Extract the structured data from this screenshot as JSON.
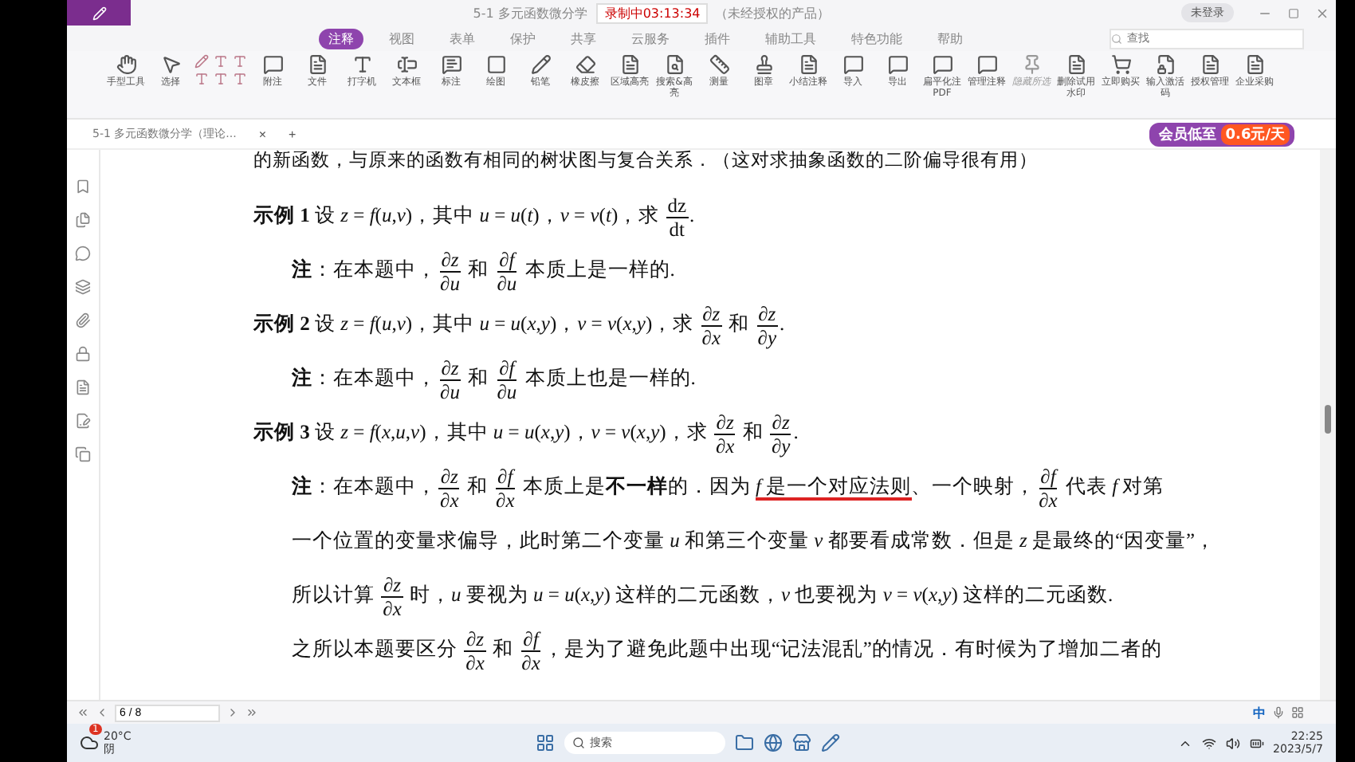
{
  "title_bar": {
    "doc_title": "5-1 多元函数微分学",
    "recording": "录制中03:13:34",
    "product_note": "（未经授权的产品）",
    "login": "未登录"
  },
  "menu_tabs": [
    {
      "label": "注释",
      "selected": true
    },
    {
      "label": "视图",
      "selected": false
    },
    {
      "label": "表单",
      "selected": false
    },
    {
      "label": "保护",
      "selected": false
    },
    {
      "label": "共享",
      "selected": false
    },
    {
      "label": "云服务",
      "selected": false
    },
    {
      "label": "插件",
      "selected": false
    },
    {
      "label": "辅助工具",
      "selected": false
    },
    {
      "label": "特色功能",
      "selected": false
    },
    {
      "label": "帮助",
      "selected": false
    }
  ],
  "search": {
    "placeholder": "查找"
  },
  "ribbon": [
    {
      "kind": "hand",
      "label": "手型工具",
      "disabled": false
    },
    {
      "kind": "select",
      "label": "选择",
      "disabled": false
    },
    {
      "kind": "textmarks",
      "disabled": false
    },
    {
      "kind": "note",
      "label": "附注",
      "disabled": false
    },
    {
      "kind": "file",
      "label": "文件",
      "disabled": false
    },
    {
      "kind": "type",
      "label": "打字机",
      "disabled": false
    },
    {
      "kind": "textbox",
      "label": "文本框",
      "disabled": false
    },
    {
      "kind": "callout",
      "label": "标注",
      "disabled": false
    },
    {
      "kind": "shape",
      "label": "绘图",
      "disabled": false
    },
    {
      "kind": "pencil",
      "label": "铅笔",
      "disabled": false
    },
    {
      "kind": "eraser",
      "label": "橡皮擦",
      "disabled": false
    },
    {
      "kind": "file",
      "label": "区域高亮",
      "disabled": false
    },
    {
      "kind": "search",
      "label": "搜索&高亮",
      "disabled": false
    },
    {
      "kind": "measure",
      "label": "测量",
      "disabled": false
    },
    {
      "kind": "stamp",
      "label": "图章",
      "disabled": false
    },
    {
      "kind": "file",
      "label": "小结注释",
      "disabled": false
    },
    {
      "kind": "note",
      "label": "导入",
      "disabled": false
    },
    {
      "kind": "note",
      "label": "导出",
      "disabled": false
    },
    {
      "kind": "note",
      "label": "扁平化注PDF",
      "disabled": false
    },
    {
      "kind": "note",
      "label": "管理注释",
      "disabled": false
    },
    {
      "kind": "pin",
      "label": "隐藏所选",
      "disabled": true
    },
    {
      "kind": "file",
      "label": "删除试用水印",
      "disabled": false
    },
    {
      "kind": "cart",
      "label": "立即购买",
      "disabled": false
    },
    {
      "kind": "lock",
      "label": "输入激活码",
      "disabled": false
    },
    {
      "kind": "file",
      "label": "授权管理",
      "disabled": false
    },
    {
      "kind": "file",
      "label": "企业采购",
      "disabled": false
    }
  ],
  "doc_tab": {
    "label": "5-1 多元函数微分学（理论...",
    "close": "×",
    "add": "+"
  },
  "promo": {
    "label": "会员低至",
    "price": "0.6元/天"
  },
  "paragraphs": [
    {
      "kind": "cut",
      "segments": [
        {
          "kind": "text",
          "text": "的新函数，与原来的函数有相同的树状图与复合关系．（这对求抽象函数的二阶偏导很有用）"
        }
      ]
    },
    {
      "kind": "example",
      "segments": [
        {
          "kind": "label",
          "text": "示例 1"
        },
        {
          "kind": "text",
          "text": " 设 *z* = *f*(*u*,*v*)，其中 *u* = *u*(*t*)，*v* = *v*(*t*)，求 "
        },
        {
          "kind": "frac",
          "num": "dz",
          "den": "dt"
        },
        {
          "kind": "text",
          "text": "."
        }
      ]
    },
    {
      "kind": "note",
      "segments": [
        {
          "kind": "label",
          "text": "注"
        },
        {
          "kind": "text",
          "text": "：在本题中，"
        },
        {
          "kind": "frac",
          "num": "∂*z*",
          "den": "∂*u*"
        },
        {
          "kind": "text",
          "text": " 和 "
        },
        {
          "kind": "frac",
          "num": "∂*f*",
          "den": "∂*u*"
        },
        {
          "kind": "text",
          "text": " 本质上是一样的."
        }
      ]
    },
    {
      "kind": "example",
      "segments": [
        {
          "kind": "label",
          "text": "示例 2"
        },
        {
          "kind": "text",
          "text": " 设 *z* = *f*(*u*,*v*)，其中 *u* = *u*(*x*,*y*)，*v* = *v*(*x*,*y*)，求 "
        },
        {
          "kind": "frac",
          "num": "∂*z*",
          "den": "∂*x*"
        },
        {
          "kind": "text",
          "text": " 和 "
        },
        {
          "kind": "frac",
          "num": "∂*z*",
          "den": "∂*y*"
        },
        {
          "kind": "text",
          "text": "."
        }
      ]
    },
    {
      "kind": "note",
      "segments": [
        {
          "kind": "label",
          "text": "注"
        },
        {
          "kind": "text",
          "text": "：在本题中，"
        },
        {
          "kind": "frac",
          "num": "∂*z*",
          "den": "∂*u*"
        },
        {
          "kind": "text",
          "text": " 和 "
        },
        {
          "kind": "frac",
          "num": "∂*f*",
          "den": "∂*u*"
        },
        {
          "kind": "text",
          "text": " 本质上也是一样的."
        }
      ]
    },
    {
      "kind": "example",
      "segments": [
        {
          "kind": "label",
          "text": "示例 3"
        },
        {
          "kind": "text",
          "text": " 设 *z* = *f*(*x*,*u*,*v*)，其中 *u* = *u*(*x*,*y*)，*v* = *v*(*x*,*y*)，求 "
        },
        {
          "kind": "frac",
          "num": "∂*z*",
          "den": "∂*x*"
        },
        {
          "kind": "text",
          "text": " 和 "
        },
        {
          "kind": "frac",
          "num": "∂*z*",
          "den": "∂*y*"
        },
        {
          "kind": "text",
          "text": "."
        }
      ]
    },
    {
      "kind": "note",
      "segments": [
        {
          "kind": "label",
          "text": "注"
        },
        {
          "kind": "text",
          "text": "：在本题中，"
        },
        {
          "kind": "frac",
          "num": "∂*z*",
          "den": "∂*x*"
        },
        {
          "kind": "text",
          "text": " 和 "
        },
        {
          "kind": "frac",
          "num": "∂*f*",
          "den": "∂*x*"
        },
        {
          "kind": "text",
          "text": " 本质上是**不一样**的．因为 "
        },
        {
          "kind": "marked",
          "text": "*f* 是一个对应法则"
        },
        {
          "kind": "text",
          "text": "、一个映射，"
        },
        {
          "kind": "frac",
          "num": "∂*f*",
          "den": "∂*x*"
        },
        {
          "kind": "text",
          "text": " 代表 *f* 对第"
        },
        {
          "kind": "text",
          "text": "一个位置的变量求偏导，"
        },
        {
          "kind": "text",
          "text": "此时第二个变量 *u* 和第三个变量 *v* 都要看成常数．"
        },
        {
          "kind": "text",
          "text": "但是 *z* 是最终的“因变量”，"
        },
        {
          "kind": "text",
          "text": "所以计算 "
        },
        {
          "kind": "frac",
          "num": "∂*z*",
          "den": "∂*x*"
        },
        {
          "kind": "text",
          "text": " 时，*u* 要视为 *u* = *u*(*x*,*y*) "
        },
        {
          "kind": "text",
          "text": "这样的二元函数，"
        },
        {
          "kind": "text",
          "text": "*v* 也要视为 *v* = *v*(*x*,*y*) "
        },
        {
          "kind": "text",
          "text": "这样的二元函数."
        }
      ]
    },
    {
      "kind": "body",
      "segments": [
        {
          "kind": "text",
          "text": "之所以本题要区分 "
        },
        {
          "kind": "frac",
          "num": "∂*z*",
          "den": "∂*x*"
        },
        {
          "kind": "text",
          "text": " 和 "
        },
        {
          "kind": "frac",
          "num": "∂*f*",
          "den": "∂*x*"
        },
        {
          "kind": "text",
          "text": "，是为了避免此题中出现“记法混乱”的情况．有时候为了增加二者的"
        }
      ]
    }
  ],
  "status_bar": {
    "page": "6 / 8"
  },
  "taskbar": {
    "weather": {
      "temp": "20°C",
      "desc": "阴",
      "alerts": "1"
    },
    "search": "搜索",
    "ime": "中",
    "time": "22:25",
    "date": "2023/5/7"
  }
}
